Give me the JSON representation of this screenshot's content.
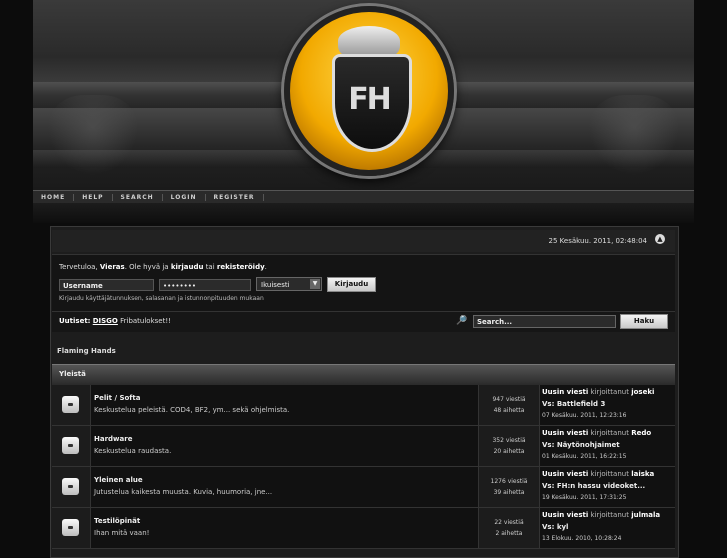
{
  "nav": [
    "HOME",
    "HELP",
    "SEARCH",
    "LOGIN",
    "REGISTER"
  ],
  "logo_text": "FH",
  "date": "25 Kesäkuu. 2011, 02:48:04",
  "login": {
    "welcome_prefix": "Tervetuloa,",
    "guest": "Vieras",
    "welcome_mid": ". Ole hyvä ja",
    "login_link": "kirjaudu",
    "or": "tai",
    "register_link": "rekisteröidy",
    "username_value": "Username",
    "password_value": "••••••••",
    "duration": "Ikuisesti",
    "submit": "Kirjaudu",
    "hint": "Kirjaudu käyttäjätunnuksen, salasanan ja istunnonpituuden mukaan"
  },
  "news": {
    "label": "Uutiset:",
    "link": "DISGO",
    "text": "Fribatulokset!!"
  },
  "search": {
    "value": "Search...",
    "button": "Haku"
  },
  "site_title": "Flaming Hands",
  "category": "Yleistä",
  "boards": [
    {
      "name": "Pelit / Softa",
      "desc": "Keskustelua peleistä. COD4, BF2, ym... sekä ohjelmista.",
      "posts": "947 viestiä",
      "topics": "48 aihetta",
      "last_prefix": "Uusin viesti",
      "last_by": "kirjoittanut",
      "last_user": "joseki",
      "last_subject": "Vs: Battlefield 3",
      "last_date": "07 Kesäkuu. 2011, 12:23:16"
    },
    {
      "name": "Hardware",
      "desc": "Keskustelua raudasta.",
      "posts": "352 viestiä",
      "topics": "20 aihetta",
      "last_prefix": "Uusin viesti",
      "last_by": "kirjoittanut",
      "last_user": "Redo",
      "last_subject": "Vs: Näytönohjaimet",
      "last_date": "01 Kesäkuu. 2011, 16:22:15"
    },
    {
      "name": "Yleinen alue",
      "desc": "Jutustelua kaikesta muusta. Kuvia, huumoria, jne...",
      "posts": "1276 viestiä",
      "topics": "39 aihetta",
      "last_prefix": "Uusin viesti",
      "last_by": "kirjoittanut",
      "last_user": "laiska",
      "last_subject": "Vs: FH:n hassu videoket...",
      "last_date": "19 Kesäkuu. 2011, 17:31:25"
    },
    {
      "name": "Testilöpinät",
      "desc": "Ihan mitä vaan!",
      "posts": "22 viestiä",
      "topics": "2 aihetta",
      "last_prefix": "Uusin viesti",
      "last_by": "kirjoittanut",
      "last_user": "julmala",
      "last_subject": "Vs: kyl",
      "last_date": "13 Elokuu. 2010, 10:28:24"
    }
  ]
}
